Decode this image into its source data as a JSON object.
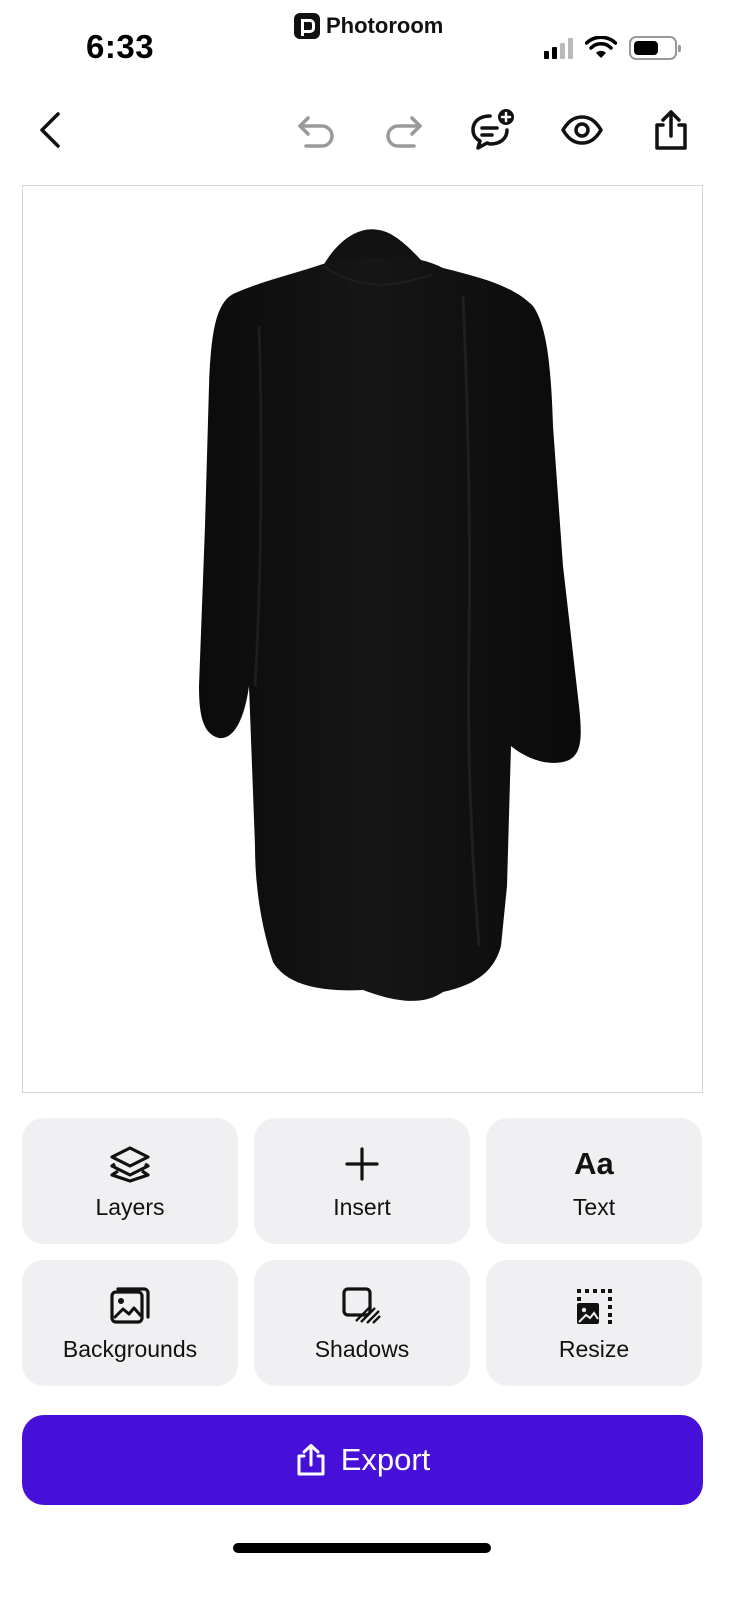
{
  "status_bar": {
    "time": "6:33",
    "app_name": "Photoroom",
    "icons": [
      "signal-icon",
      "wifi-icon",
      "battery-icon"
    ]
  },
  "toolbar": {
    "buttons": [
      "back-icon",
      "undo-icon",
      "redo-icon",
      "comment-add-icon",
      "preview-eye-icon",
      "share-icon"
    ]
  },
  "canvas": {
    "subject": "black-coat-image"
  },
  "tools": {
    "layers": {
      "label": "Layers",
      "icon": "layers-icon"
    },
    "insert": {
      "label": "Insert",
      "icon": "plus-icon"
    },
    "text": {
      "label": "Text",
      "icon": "text-aa-icon",
      "glyph": "Aa"
    },
    "backgrounds": {
      "label": "Backgrounds",
      "icon": "backgrounds-icon"
    },
    "shadows": {
      "label": "Shadows",
      "icon": "shadows-icon"
    },
    "resize": {
      "label": "Resize",
      "icon": "resize-icon"
    }
  },
  "export": {
    "label": "Export",
    "icon": "share-icon",
    "color": "#4610d9"
  },
  "colors": {
    "accent": "#4610d9",
    "tile_bg": "#f0f0f3",
    "disabled_icon": "#9a9a9a"
  }
}
